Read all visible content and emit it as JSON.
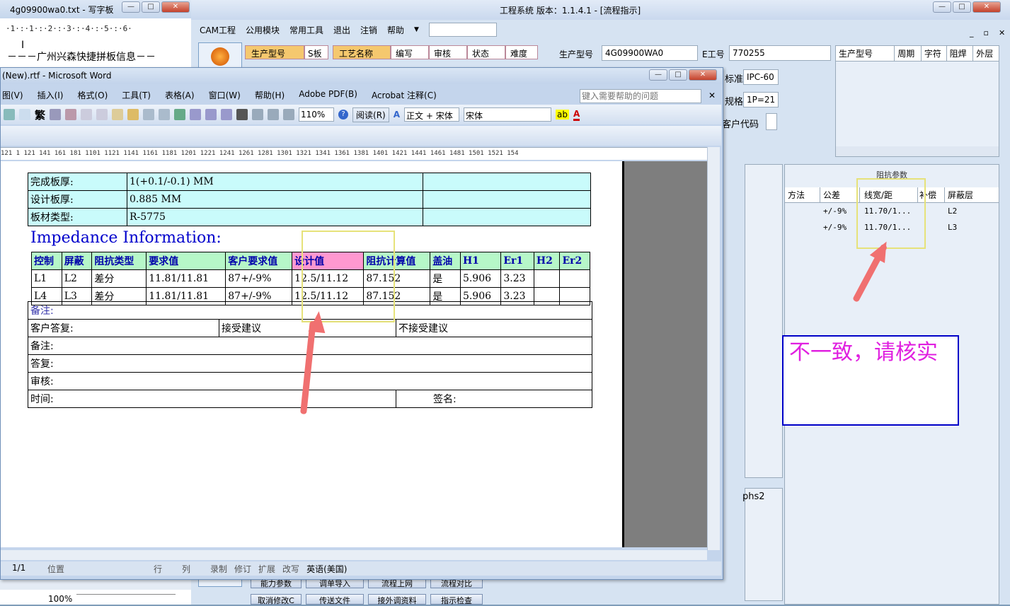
{
  "wordpad": {
    "title": "4g09900wa0.txt - 写字板",
    "ruler": "·1·:·1·:·2·:·3·:·4·:·5·:·6·",
    "text": "－－－广州兴森快捷拼板信息－－"
  },
  "eng": {
    "title": "工程系统  版本：1.1.4.1 - [流程指示]",
    "menu": [
      "CAM工程",
      "公用模块",
      "常用工具",
      "退出",
      "注销",
      "帮助"
    ],
    "grid_headers1": [
      "生产型号",
      "S板"
    ],
    "grid_headers2": [
      "工艺名称",
      "编写",
      "审核",
      "状态",
      "难度"
    ],
    "prod_label": "生产型号",
    "prod_value": "4G09900WA0",
    "e_label": "E工号",
    "e_value": "770255",
    "std_label": "标准",
    "std_value": "IPC-60",
    "spec_label": "规格",
    "spec_value": "1P=21",
    "cust_label": "客户代码",
    "top_headers": [
      "生产型号",
      "周期",
      "字符",
      "阻焊",
      "外层"
    ],
    "imp_group_title": "阻抗参数",
    "imp_headers": [
      "方法",
      "公差",
      "线宽/距",
      "补偿",
      "屏蔽层"
    ],
    "imp_rows": [
      [
        "",
        "+/-9%",
        "11.70/1...",
        "",
        "L2"
      ],
      [
        "",
        "+/-9%",
        "11.70/1...",
        "",
        "L3"
      ]
    ],
    "note": "不一致，请核实",
    "side_text": "phs2",
    "bottom_buttons": [
      "能力参数",
      "调单导入",
      "流程上网",
      "流程对比",
      "取消修改C",
      "传送文件",
      "接外调资料",
      "指示检查"
    ],
    "zoom": "100%"
  },
  "word": {
    "title": "(New).rtf - Microsoft Word",
    "menu": [
      "图(V)",
      "插入(I)",
      "格式(O)",
      "工具(T)",
      "表格(A)",
      "窗口(W)",
      "帮助(H)",
      "Adobe PDF(B)",
      "Acrobat 注释(C)"
    ],
    "help_placeholder": "键入需要帮助的问题",
    "zoom": "110%",
    "read_label": "阅读(R)",
    "style": "正文 + 宋体",
    "font": "宋体",
    "trad": "繁",
    "ruler": "121  1  121  141  161  181  1101  1121  1141  1161  1181  1201  1221  1241  1261  1281  1301  1321  1341  1361  1381  1401  1421  1441  1461  1481  1501  1521  154",
    "info_rows": [
      [
        "完成板厚:",
        "1(+0.1/-0.1) MM"
      ],
      [
        "设计板厚:",
        "0.885 MM"
      ],
      [
        "板材类型:",
        "R-5775"
      ]
    ],
    "impedance_title": "Impedance Information:",
    "imp_headers": [
      "控制",
      "屏蔽",
      "阻抗类型",
      "要求值",
      "客户要求值",
      "设计值",
      "阻抗计算值",
      "盖油",
      "H1",
      "Er1",
      "H2",
      "Er2"
    ],
    "imp_rows": [
      [
        "L1",
        "L2",
        "差分",
        "11.81/11.81",
        "87+/-9%",
        "12.5/11.12",
        "87.152",
        "是",
        "5.906",
        "3.23",
        "",
        ""
      ],
      [
        "L4",
        "L3",
        "差分",
        "11.81/11.81",
        "87+/-9%",
        "12.5/11.12",
        "87.152",
        "是",
        "5.906",
        "3.23",
        "",
        ""
      ]
    ],
    "remark": "备注:",
    "cust_reply": "客户答复:",
    "accept": "接受建议",
    "reject": "不接受建议",
    "remark2": "备注:",
    "reply": "答复:",
    "review": "审核:",
    "time": "时间:",
    "sign": "签名:",
    "status": [
      "1/1",
      "位置",
      "行",
      "列",
      "录制",
      "修订",
      "扩展",
      "改写",
      "英语(美国)"
    ]
  },
  "colors": {
    "annotation_box": "#e6e27a",
    "arrow": "#f07070",
    "note_border": "#0000c8",
    "note_text": "#e020e0"
  }
}
